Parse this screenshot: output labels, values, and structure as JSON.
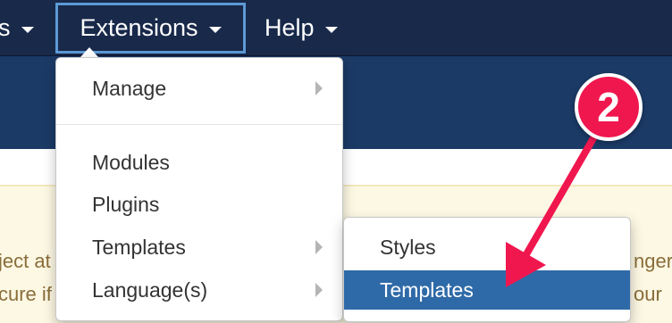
{
  "navbar": {
    "items": [
      {
        "label": "s"
      },
      {
        "label": "Extensions"
      },
      {
        "label": "Help"
      }
    ]
  },
  "dropdown": {
    "items": [
      {
        "label": "Manage",
        "has_submenu": true
      },
      {
        "label": "Modules",
        "has_submenu": false
      },
      {
        "label": "Plugins",
        "has_submenu": false
      },
      {
        "label": "Templates",
        "has_submenu": true
      },
      {
        "label": "Language(s)",
        "has_submenu": true
      }
    ]
  },
  "submenu": {
    "items": [
      {
        "label": "Styles",
        "active": false
      },
      {
        "label": "Templates",
        "active": true
      }
    ]
  },
  "message": {
    "left_line1": "ject at",
    "left_line2": "cure if",
    "right_line1": "nger",
    "right_line2": "our"
  },
  "callout": {
    "number": "2",
    "color": "#f0174f"
  },
  "colors": {
    "navbar": "#18294a",
    "subheader": "#1b3a66",
    "active_item": "#2f6aa8",
    "message_bg": "#fcf8e3",
    "message_text": "#8a6d3b"
  }
}
